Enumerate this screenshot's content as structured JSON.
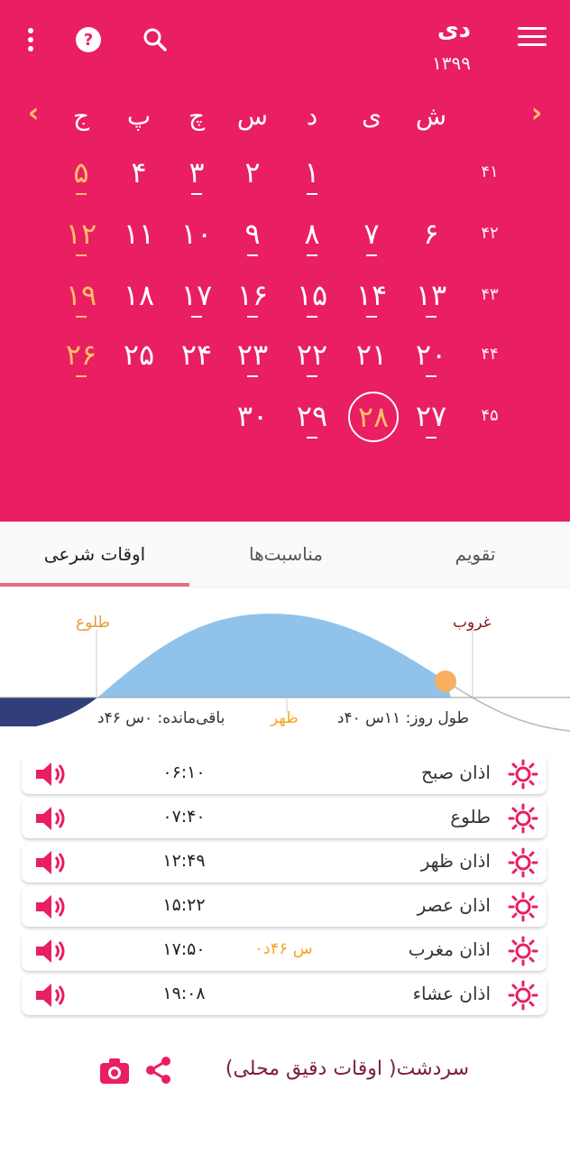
{
  "header": {
    "month": "دی",
    "year": "۱۳۹۹"
  },
  "weekdays": [
    "ش",
    "ی",
    "د",
    "س",
    "چ",
    "پ",
    "ج"
  ],
  "weeks": [
    {
      "num": "۴۱",
      "days": [
        "",
        "",
        "۱",
        "۲",
        "۳",
        "۴",
        "۵"
      ]
    },
    {
      "num": "۴۲",
      "days": [
        "۶",
        "۷",
        "۸",
        "۹",
        "۱۰",
        "۱۱",
        "۱۲"
      ]
    },
    {
      "num": "۴۳",
      "days": [
        "۱۳",
        "۱۴",
        "۱۵",
        "۱۶",
        "۱۷",
        "۱۸",
        "۱۹"
      ]
    },
    {
      "num": "۴۴",
      "days": [
        "۲۰",
        "۲۱",
        "۲۲",
        "۲۳",
        "۲۴",
        "۲۵",
        "۲۶"
      ]
    },
    {
      "num": "۴۵",
      "days": [
        "۲۷",
        "۲۸",
        "۲۹",
        "۳۰",
        "",
        "",
        ""
      ]
    }
  ],
  "tabs": [
    "تقویم",
    "مناسبت‌ها",
    "اوقات شرعی"
  ],
  "sun": {
    "sunrise_label": "طلوع",
    "sunset_label": "غروب",
    "noon_label": "ظهر",
    "day_length": "طول روز: ۱۱س ۴۰د",
    "remaining": "باقی‌مانده: ۰س ۴۶د"
  },
  "prayers": [
    {
      "label": "اذان صبح",
      "time": "۰۶:۱۰",
      "remain": ""
    },
    {
      "label": "طلوع",
      "time": "۰۷:۴۰",
      "remain": ""
    },
    {
      "label": "اذان ظهر",
      "time": "۱۲:۴۹",
      "remain": ""
    },
    {
      "label": "اذان عصر",
      "time": "۱۵:۲۲",
      "remain": ""
    },
    {
      "label": "اذان مغرب",
      "time": "۱۷:۵۰",
      "remain": "۰س ۴۶د"
    },
    {
      "label": "اذان عشاء",
      "time": "۱۹:۰۸",
      "remain": ""
    }
  ],
  "footer": {
    "location": "سردشت( اوقات دقیق محلی)"
  },
  "colors": {
    "accent": "#e91e63",
    "holiday": "#ffc066",
    "today_ring": "#ffffff"
  }
}
